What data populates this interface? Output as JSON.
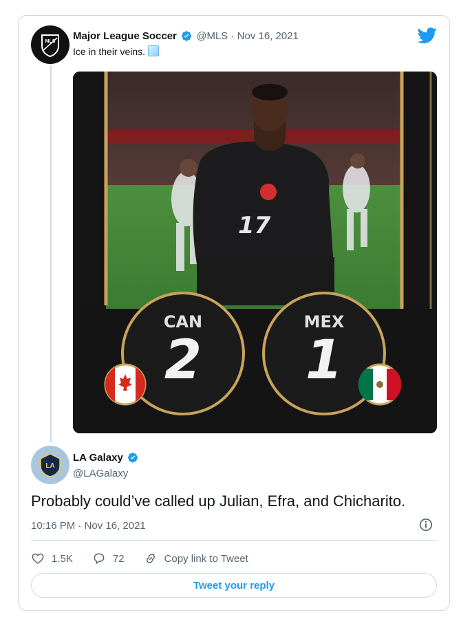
{
  "tweet": {
    "display_name": "Major League Soccer",
    "handle": "@MLS",
    "separator": "·",
    "date": "Nov 16, 2021",
    "text": "Ice in their veins.",
    "avatar_text": "MLS",
    "media": {
      "team1": "CAN",
      "score1": "2",
      "team2": "MEX",
      "score2": "1",
      "jersey_number": "17"
    }
  },
  "reply": {
    "display_name": "LA Galaxy",
    "handle": "@LAGalaxy",
    "avatar_text": "LA",
    "text": "Probably could’ve called up Julian, Efra, and Chicharito.",
    "timestamp": "10:16 PM · Nov 16, 2021",
    "likes": "1.5K",
    "replies": "72",
    "copy_link_label": "Copy link to Tweet",
    "reply_button_label": "Tweet your reply"
  },
  "colors": {
    "accent": "#1d9bf0",
    "gold": "#c8a35a",
    "muted": "#536471"
  },
  "icons": [
    "twitter-bird-icon",
    "verified-icon",
    "ice-cube-icon",
    "info-icon",
    "heart-icon",
    "reply-icon",
    "link-icon",
    "canada-flag-icon",
    "mexico-flag-icon"
  ]
}
